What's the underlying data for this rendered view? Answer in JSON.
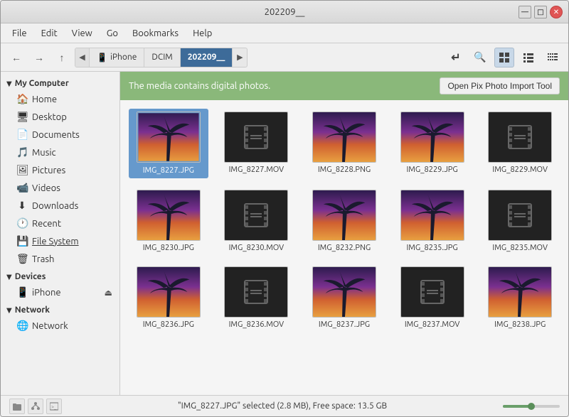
{
  "window": {
    "title": "202209__",
    "controls": {
      "minimize": "—",
      "maximize": "□",
      "close": "✕"
    }
  },
  "menubar": {
    "items": [
      "File",
      "Edit",
      "View",
      "Go",
      "Bookmarks",
      "Help"
    ]
  },
  "toolbar": {
    "back": "←",
    "forward": "→",
    "up": "↑",
    "breadcrumb": {
      "prev_arrow": "◀",
      "next_arrow": "▶",
      "items": [
        {
          "label": "iPhone",
          "icon": "📱",
          "active": false
        },
        {
          "label": "DCIM",
          "active": false
        },
        {
          "label": "202209__",
          "active": true
        }
      ]
    },
    "sort_icon": "↵",
    "search_icon": "🔍",
    "view_icons": [
      "▦",
      "☰",
      "⋮⋮"
    ]
  },
  "infobar": {
    "message": "The media contains digital photos.",
    "button": "Open Pix Photo Import Tool"
  },
  "sidebar": {
    "sections": [
      {
        "id": "my-computer",
        "label": "My Computer",
        "items": [
          {
            "id": "home",
            "label": "Home",
            "icon": "🏠"
          },
          {
            "id": "desktop",
            "label": "Desktop",
            "icon": "🖥"
          },
          {
            "id": "documents",
            "label": "Documents",
            "icon": "📄"
          },
          {
            "id": "music",
            "label": "Music",
            "icon": "🎵"
          },
          {
            "id": "pictures",
            "label": "Pictures",
            "icon": "🖼"
          },
          {
            "id": "videos",
            "label": "Videos",
            "icon": "📹"
          },
          {
            "id": "downloads",
            "label": "Downloads",
            "icon": "⬇"
          },
          {
            "id": "recent",
            "label": "Recent",
            "icon": "🕐"
          },
          {
            "id": "file-system",
            "label": "File System",
            "icon": "💾",
            "underline": true
          }
        ]
      },
      {
        "id": "trash",
        "items": [
          {
            "id": "trash",
            "label": "Trash",
            "icon": "🗑"
          }
        ]
      },
      {
        "id": "devices",
        "label": "Devices",
        "items": [
          {
            "id": "iphone",
            "label": "iPhone",
            "icon": "📱",
            "eject": true
          }
        ]
      },
      {
        "id": "network",
        "label": "Network",
        "items": [
          {
            "id": "network-item",
            "label": "Network",
            "icon": "🌐"
          }
        ]
      }
    ]
  },
  "files": [
    {
      "name": "IMG_8227.JPG",
      "type": "photo",
      "selected": true
    },
    {
      "name": "IMG_8227.MOV",
      "type": "video",
      "selected": false
    },
    {
      "name": "IMG_8228.PNG",
      "type": "photo",
      "selected": false
    },
    {
      "name": "IMG_8229.JPG",
      "type": "photo",
      "selected": false
    },
    {
      "name": "IMG_8229.MOV",
      "type": "video",
      "selected": false
    },
    {
      "name": "IMG_8230.JPG",
      "type": "photo",
      "selected": false
    },
    {
      "name": "IMG_8230.MOV",
      "type": "video",
      "selected": false
    },
    {
      "name": "IMG_8232.PNG",
      "type": "photo",
      "selected": false
    },
    {
      "name": "IMG_8235.JPG",
      "type": "photo",
      "selected": false
    },
    {
      "name": "IMG_8235.MOV",
      "type": "video",
      "selected": false
    },
    {
      "name": "IMG_8236.JPG",
      "type": "photo",
      "selected": false
    },
    {
      "name": "IMG_8236.MOV",
      "type": "video",
      "selected": false
    },
    {
      "name": "IMG_8237.JPG",
      "type": "photo",
      "selected": false
    },
    {
      "name": "IMG_8237.MOV",
      "type": "video",
      "selected": false
    },
    {
      "name": "IMG_8238.JPG",
      "type": "photo",
      "selected": false
    }
  ],
  "statusbar": {
    "message": "\"IMG_8227.JPG\" selected (2.8 MB), Free space: 13.5 GB",
    "zoom_value": 50
  }
}
